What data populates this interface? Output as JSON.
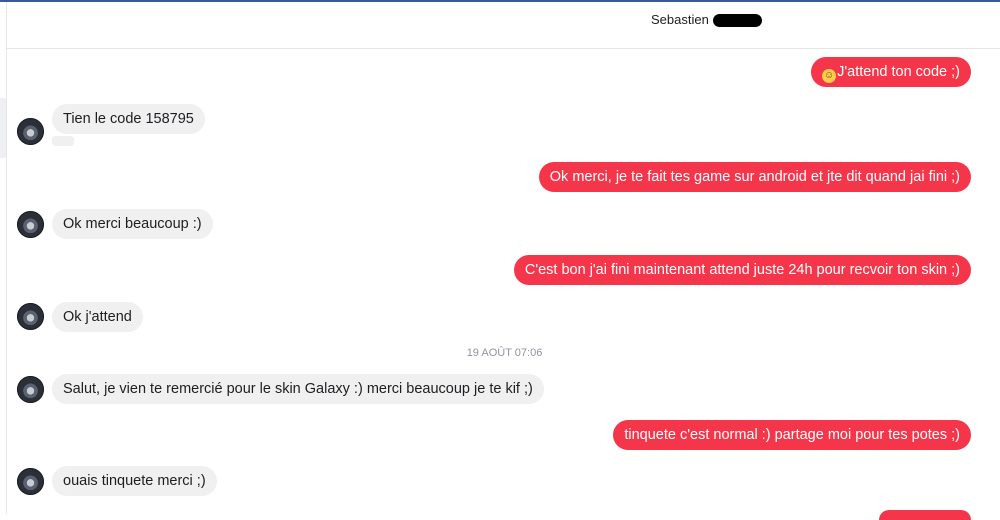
{
  "header": {
    "contact_name": "Sebastien"
  },
  "messages": {
    "m1": {
      "text": "J'attend ton code ;)",
      "emoji": "☺"
    },
    "m2": {
      "text": "Tien le code 158795"
    },
    "m3": {
      "text": "Ok merci, je te fait tes game sur android et jte dit quand jai fini ;)"
    },
    "m4": {
      "text": "Ok merci beaucoup :)"
    },
    "m5": {
      "text": "C'est bon j'ai fini maintenant attend juste 24h pour recvoir ton skin ;)"
    },
    "m6": {
      "text": "Ok j'attend"
    },
    "m7": {
      "text": "Salut, je vien te remercié pour le skin Galaxy :) merci beaucoup je te kif ;)"
    },
    "m8": {
      "text": "tinquete c'est normal :) partage moi pour tes potes ;)"
    },
    "m9": {
      "text": "ouais tinquete merci ;)"
    }
  },
  "timestamp": "19 AOÛT 07:06",
  "colors": {
    "outgoing": "#f5364a",
    "incoming": "#f0f0f0",
    "accent": "#3b5998"
  }
}
